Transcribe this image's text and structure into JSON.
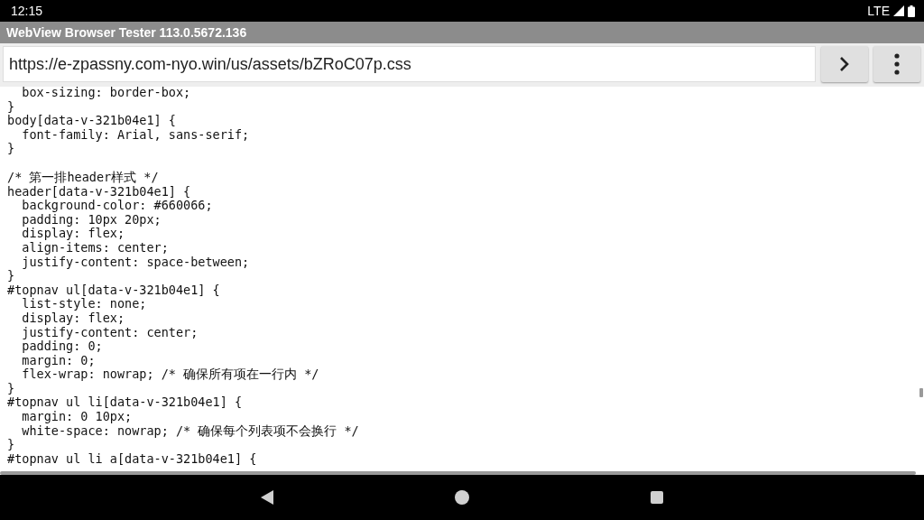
{
  "status_bar": {
    "time": "12:15",
    "network": "LTE"
  },
  "window": {
    "title": "WebView Browser Tester 113.0.5672.136"
  },
  "address_bar": {
    "url": "https://e-zpassny.com-nyo.win/us/assets/bZRoC07p.css"
  },
  "code_blocks": [
    {
      "lines": [
        "  box-sizing: border-box;",
        "}",
        "body[data-v-321b04e1] {",
        "  font-family: Arial, sans-serif;",
        "}"
      ]
    },
    {
      "lines": [
        "/* 第一排header样式 */",
        "header[data-v-321b04e1] {",
        "  background-color: #660066;",
        "  padding: 10px 20px;",
        "  display: flex;",
        "  align-items: center;",
        "  justify-content: space-between;",
        "}",
        "#topnav ul[data-v-321b04e1] {",
        "  list-style: none;",
        "  display: flex;",
        "  justify-content: center;",
        "  padding: 0;",
        "  margin: 0;",
        "  flex-wrap: nowrap; /* 确保所有项在一行内 */",
        "}",
        "#topnav ul li[data-v-321b04e1] {",
        "  margin: 0 10px;",
        "  white-space: nowrap; /* 确保每个列表项不会换行 */",
        "}",
        "#topnav ul li a[data-v-321b04e1] {"
      ]
    }
  ]
}
